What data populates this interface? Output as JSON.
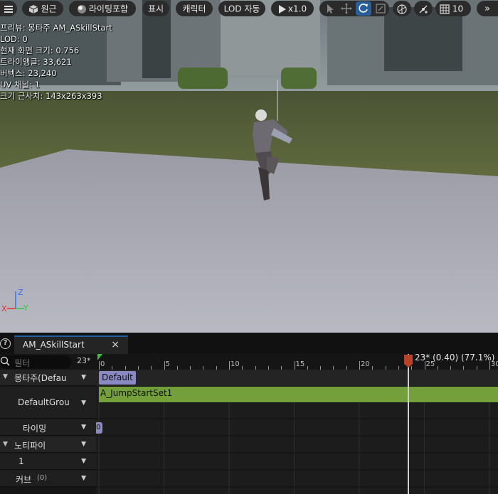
{
  "toolbar": {
    "perspective": "원근",
    "lighting": "라이팅포함",
    "show": "표시",
    "character": "캐릭터",
    "lod": "LOD 자동",
    "playspeed": "x1.0",
    "grid_value": "10"
  },
  "stats": {
    "preview": "프리뷰: 몽타주 AM_ASkillStart",
    "lod": "LOD: 0",
    "screen_size": "현재 화면 크기: 0.756",
    "triangles": "트라이앵글: 33,621",
    "vertices": "버텍스: 23,240",
    "uv_channels": "UV 채널: 1",
    "approx_size": "크기 근사치: 143x263x393"
  },
  "gizmo": {
    "z": "Z",
    "y": "Y",
    "x": "X"
  },
  "panel": {
    "help": "?",
    "tab_label": "AM_ASkillStart",
    "tab_close": "×",
    "filter_placeholder": "필터",
    "frame_indicator": "23*",
    "rows": {
      "montage": "몽타주(Defau",
      "group": "DefaultGroup",
      "timing": "타이밍",
      "notify": "노티파이",
      "notify_track": "1",
      "curves": "커브",
      "curves_count": "(0)"
    },
    "ruler_ticks": [
      "0",
      "5",
      "10",
      "15",
      "20",
      "25",
      "30"
    ],
    "playhead_label": "23* (0.40) (77.1%)",
    "section_label": "Default",
    "anim_segment": "A_JumpStartSet1",
    "timing_marker": "0"
  },
  "colors": {
    "accent_blue": "#2a5f9a",
    "section_purple": "#8b89c2",
    "anim_green": "#73a03b",
    "playhead_red": "#b4432a"
  }
}
